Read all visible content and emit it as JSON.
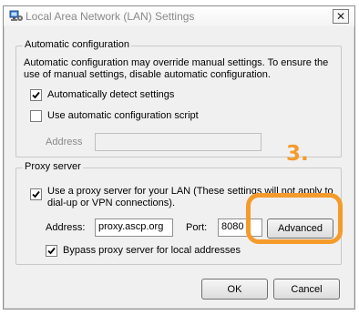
{
  "window": {
    "title": "Local Area Network (LAN) Settings",
    "close_glyph": "✕"
  },
  "auto_config": {
    "legend": "Automatic configuration",
    "description_line1": "Automatic configuration may override manual settings.  To ensure the",
    "description_line2": "use of manual settings, disable automatic configuration.",
    "detect_label": "Automatically detect settings",
    "detect_checked": true,
    "script_label": "Use automatic configuration script",
    "script_checked": false,
    "address_label": "Address",
    "address_value": ""
  },
  "proxy": {
    "legend": "Proxy server",
    "use_proxy_line1": "Use a proxy server for your LAN (These settings will not apply to",
    "use_proxy_line2": "dial-up or VPN connections).",
    "use_proxy_checked": true,
    "address_label": "Address:",
    "address_value": "proxy.ascp.org",
    "port_label": "Port:",
    "port_value": "8080",
    "advanced_label": "Advanced",
    "bypass_label": "Bypass proxy server for local addresses",
    "bypass_checked": true
  },
  "annotation": {
    "step": "3.",
    "color": "#f59b2c"
  },
  "buttons": {
    "ok": "OK",
    "cancel": "Cancel"
  }
}
